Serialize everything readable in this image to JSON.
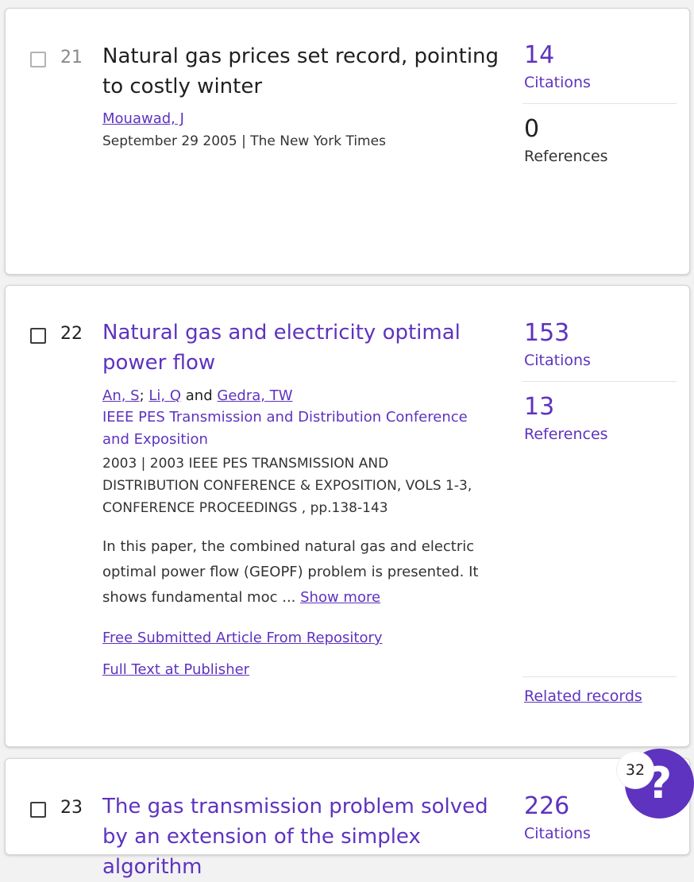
{
  "results": [
    {
      "number": "21",
      "title": "Natural gas prices set record, pointing to costly winter",
      "author": "Mouawad, J",
      "meta": "September 29 2005 | The New York Times",
      "citations_count": "14",
      "citations_label": "Citations",
      "references_count": "0",
      "references_label": "References"
    },
    {
      "number": "22",
      "title": "Natural gas and electricity optimal power flow",
      "authors": [
        "An, S",
        "Li, Q",
        "Gedra, TW"
      ],
      "authors_sep": ";",
      "authors_and": "and",
      "source": "IEEE PES Transmission and Distribution Conference and Exposition",
      "meta": "2003 | 2003 IEEE PES TRANSMISSION AND DISTRIBUTION CONFERENCE & EXPOSITION, VOLS 1-3, CONFERENCE PROCEEDINGS , pp.138-143",
      "abstract": "In this paper, the combined natural gas and electric optimal power flow (GEOPF) problem is presented. It shows fundamental moc ...",
      "show_more": "Show more",
      "link1": "Free Submitted Article From Repository",
      "link2": "Full Text at Publisher",
      "citations_count": "153",
      "citations_label": "Citations",
      "references_count": "13",
      "references_label": "References",
      "related_records": "Related records"
    },
    {
      "number": "23",
      "title": "The gas transmission problem solved by an extension of the simplex algorithm",
      "citations_count": "226",
      "citations_label": "Citations"
    }
  ],
  "help_widget": {
    "badge": "32",
    "icon": "question-mark-icon",
    "glyph": "?"
  },
  "colors": {
    "link": "#5e33bf",
    "help_bg": "#5e33bf"
  }
}
